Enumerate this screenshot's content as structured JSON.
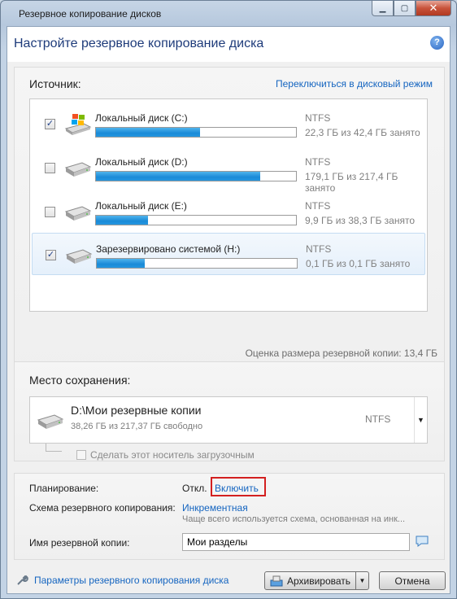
{
  "window": {
    "title": "Резервное копирование дисков",
    "controls": {
      "minimize": "▁",
      "maximize": "▢",
      "close": "✕"
    }
  },
  "header": {
    "title": "Настройте резервное копирование диска",
    "help_icon_glyph": "?"
  },
  "source": {
    "label": "Источник:",
    "switch_link": "Переключиться в дисковый режим",
    "disks": [
      {
        "name": "Локальный диск (C:)",
        "fs": "NTFS",
        "usage": "22,3 ГБ из 42,4 ГБ занято",
        "checked": true,
        "selected": false,
        "fill": 0.52,
        "icon": "windows-drive-icon"
      },
      {
        "name": "Локальный диск (D:)",
        "fs": "NTFS",
        "usage": "179,1 ГБ из 217,4 ГБ занято",
        "checked": false,
        "selected": false,
        "fill": 0.82,
        "icon": "hard-drive-icon"
      },
      {
        "name": "Локальный диск (E:)",
        "fs": "NTFS",
        "usage": "9,9 ГБ из 38,3 ГБ занято",
        "checked": false,
        "selected": false,
        "fill": 0.26,
        "icon": "hard-drive-icon"
      },
      {
        "name": "Зарезервировано системой (H:)",
        "fs": "NTFS",
        "usage": "0,1 ГБ из 0,1 ГБ занято",
        "checked": true,
        "selected": true,
        "fill": 0.24,
        "icon": "hard-drive-icon"
      }
    ],
    "estimate": "Оценка размера резервной копии: 13,4 ГБ"
  },
  "destination": {
    "label": "Место сохранения:",
    "path": "D:\\Мои резервные копии",
    "free": "38,26 ГБ из 217,37 ГБ свободно",
    "fs": "NTFS",
    "bootable_label": "Сделать этот носитель загрузочным",
    "bootable_checked": false
  },
  "options": {
    "schedule_label": "Планирование:",
    "schedule_value": "Откл.",
    "schedule_enable": "Включить",
    "scheme_label": "Схема резервного копирования:",
    "scheme_value": "Инкрементная",
    "scheme_desc": "Чаще всего используется схема, основанная на инк...",
    "name_label": "Имя резервной копии:",
    "name_value": "Мои разделы"
  },
  "footer": {
    "settings_link": "Параметры резервного копирования диска",
    "archive_button": "Архивировать",
    "cancel_button": "Отмена"
  },
  "colors": {
    "accent_link": "#1565c0",
    "progress": "#1a8ad7",
    "highlight": "#d32020"
  }
}
